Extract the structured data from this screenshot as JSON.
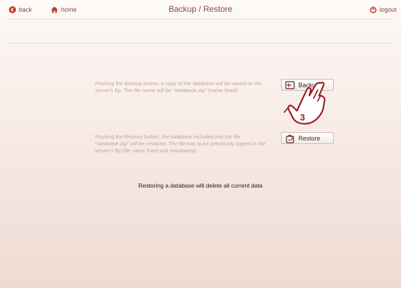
{
  "header": {
    "back_label": "back",
    "home_label": "home",
    "title": "Backup / Restore",
    "logout_label": "logout"
  },
  "backup": {
    "description": "Pushing the Backup button, a copy of the database will be saved on the server's ftp. The file name will be \"database.zip\" (name fixed)",
    "button_label": "Backup"
  },
  "restore": {
    "description": "Pushing the Restore button, the database included into the file \"database.zip\" will be restored. The file has to be previously copied in the server's ftp (file name fixed and mandatory)",
    "button_label": "Restore"
  },
  "warning": "Restoring a database will delete all current data",
  "callout": {
    "step_number": "3",
    "icon": "hand-pointer-icon",
    "color": "#9b1b22"
  },
  "colors": {
    "accent": "#c0392b",
    "header_text": "#8a4a3a",
    "description_text": "#c2a59a"
  }
}
